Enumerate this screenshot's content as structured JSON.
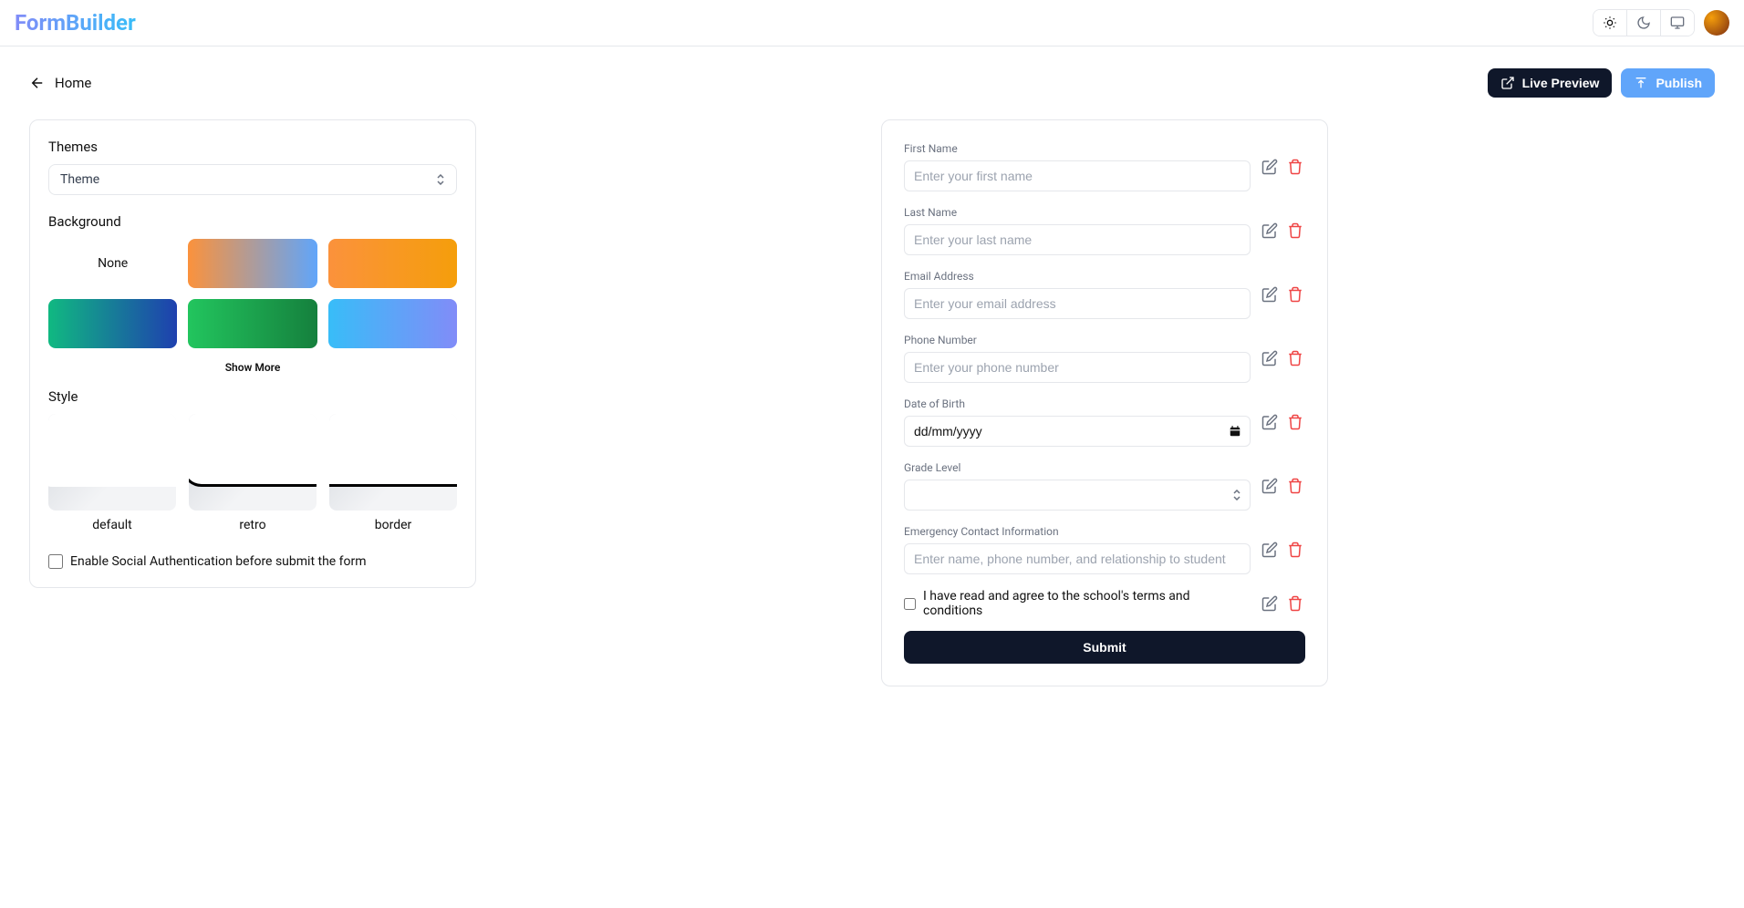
{
  "logo": "FormBuilder",
  "back_label": "Home",
  "buttons": {
    "live_preview": "Live Preview",
    "publish": "Publish"
  },
  "themes": {
    "section_label": "Themes",
    "select_label": "Theme"
  },
  "background": {
    "section_label": "Background",
    "none_label": "None",
    "show_more": "Show More",
    "swatches": [
      {
        "id": "none"
      },
      {
        "id": "amber-blue",
        "gradient": "linear-gradient(90deg, #fb923c, #60a5fa)"
      },
      {
        "id": "orange-amber",
        "gradient": "linear-gradient(90deg, #fb923c, #f59e0b)"
      },
      {
        "id": "teal-blue",
        "gradient": "linear-gradient(90deg, #10b981, #1e40af)"
      },
      {
        "id": "green",
        "gradient": "linear-gradient(90deg, #22c55e, #15803d)"
      },
      {
        "id": "sky-indigo",
        "gradient": "linear-gradient(90deg, #38bdf8, #818cf8)"
      }
    ]
  },
  "style": {
    "section_label": "Style",
    "options": [
      {
        "id": "default",
        "label": "default"
      },
      {
        "id": "retro",
        "label": "retro"
      },
      {
        "id": "border",
        "label": "border"
      }
    ]
  },
  "social_auth_label": "Enable Social Authentication before submit the form",
  "form": {
    "fields": [
      {
        "label": "First Name",
        "placeholder": "Enter your first name",
        "type": "text"
      },
      {
        "label": "Last Name",
        "placeholder": "Enter your last name",
        "type": "text"
      },
      {
        "label": "Email Address",
        "placeholder": "Enter your email address",
        "type": "text"
      },
      {
        "label": "Phone Number",
        "placeholder": "Enter your phone number",
        "type": "text"
      },
      {
        "label": "Date of Birth",
        "placeholder": "dd/mm/yyyy",
        "type": "date"
      },
      {
        "label": "Grade Level",
        "placeholder": "",
        "type": "select"
      },
      {
        "label": "Emergency Contact Information",
        "placeholder": "Enter name, phone number, and relationship to student",
        "type": "text"
      }
    ],
    "terms_label": "I have read and agree to the school's terms and conditions",
    "submit_label": "Submit"
  }
}
